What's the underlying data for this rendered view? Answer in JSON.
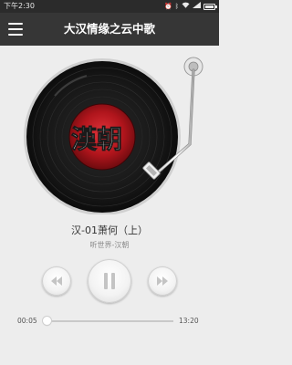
{
  "status_bar": {
    "time": "下午2:30",
    "icons": [
      "alarm-icon",
      "bluetooth-icon",
      "wifi-icon",
      "signal-icon",
      "battery-icon"
    ]
  },
  "header": {
    "title": "大汉情缘之云中歌",
    "menu_icon": "hamburger-menu-icon"
  },
  "now_playing": {
    "track_title": "汉-01萧何（上）",
    "artist": "听世界-汉朝",
    "album_logo_text": "漢朝",
    "progress_fraction": 0.03
  },
  "controls": {
    "prev_icon": "rewind-icon",
    "play_icon": "pause-icon",
    "next_icon": "fast-forward-icon"
  },
  "progress": {
    "current_time": "00:05",
    "total_time": "13:20"
  },
  "colors": {
    "header_bg": "#363636",
    "status_bg": "#2b2b2b",
    "page_bg": "#ededed",
    "label_red": "#b0151c"
  }
}
